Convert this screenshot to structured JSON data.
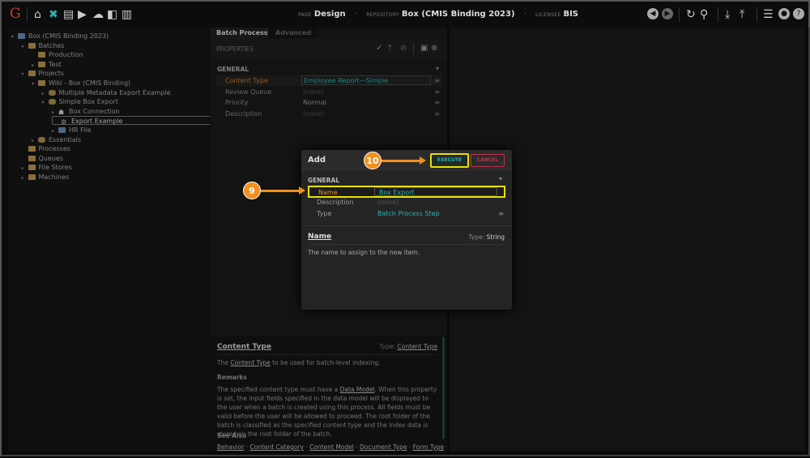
{
  "topbar": {
    "logo": "G",
    "icons": [
      "home-icon",
      "tools-icon",
      "archive-icon",
      "media-icon",
      "cloud-upload-icon",
      "briefcase-clock-icon",
      "chart-icon"
    ],
    "page_label": "PAGE",
    "page": "Design",
    "repo_label": "REPOSITORY",
    "repo": "Box (CMIS Binding 2023)",
    "licensee_label": "LICENSEE",
    "licensee": "BIS"
  },
  "tree": [
    {
      "label": "Box (CMIS Binding 2023)",
      "depth": 0,
      "tw": "▾",
      "icon": "repo"
    },
    {
      "label": "Batches",
      "depth": 1,
      "tw": "▾",
      "icon": "folder"
    },
    {
      "label": "Production",
      "depth": 2,
      "tw": "",
      "icon": "folder"
    },
    {
      "label": "Test",
      "depth": 2,
      "tw": "▸",
      "icon": "folder"
    },
    {
      "label": "Projects",
      "depth": 1,
      "tw": "▾",
      "icon": "folder"
    },
    {
      "label": "Wiki - Box (CMIS Binding)",
      "depth": 2,
      "tw": "▾",
      "icon": "folder"
    },
    {
      "label": "Multiple Metadata Export Example",
      "depth": 3,
      "tw": "▸",
      "icon": "package"
    },
    {
      "label": "Simple Box Export",
      "depth": 3,
      "tw": "▾",
      "icon": "package"
    },
    {
      "label": "Box Connection",
      "depth": 4,
      "tw": "▸",
      "icon": "connection"
    },
    {
      "label": "Export Example",
      "depth": 4,
      "tw": "",
      "icon": "gear",
      "selected": true
    },
    {
      "label": "HR File",
      "depth": 4,
      "tw": "▸",
      "icon": "file"
    },
    {
      "label": "Essentials",
      "depth": 2,
      "tw": "▸",
      "icon": "package"
    },
    {
      "label": "Processes",
      "depth": 1,
      "tw": "",
      "icon": "folder"
    },
    {
      "label": "Queues",
      "depth": 1,
      "tw": "",
      "icon": "folder"
    },
    {
      "label": "File Stores",
      "depth": 1,
      "tw": "▸",
      "icon": "folder"
    },
    {
      "label": "Machines",
      "depth": 1,
      "tw": "▸",
      "icon": "folder"
    }
  ],
  "props": {
    "tabs": [
      "Batch Process",
      "Advanced"
    ],
    "header": "PROPERTIES",
    "section": "GENERAL",
    "rows": [
      {
        "label": "Content Type",
        "value": "Employee Report—Simple"
      },
      {
        "label": "Review Queue",
        "value": "(none)"
      },
      {
        "label": "Priority",
        "value": "Normal"
      },
      {
        "label": "Description",
        "value": "(none)"
      }
    ]
  },
  "help": {
    "title": "Content Type",
    "type_label": "Type:",
    "type": "Content Type",
    "desc_pre": "The ",
    "desc_link": "Content Type",
    "desc_post": " to be used for batch-level indexing.",
    "remarks_title": "Remarks",
    "remarks_pre": "The specified content type must have a ",
    "remarks_link": "Data Model",
    "remarks_post": ". When this property is set, the input fields specified in the data model will be displayed to the user when a batch is created using this process. All fields must be valid before the user will be allowed to proceed. The root folder of the batch is classified as the specified content type and the index data is stored on the root folder of the batch.",
    "see_also_title": "See Also",
    "see_also": [
      "Behavior",
      "Content Category",
      "Content Model",
      "Document Type",
      "Form Type"
    ]
  },
  "dialog": {
    "title": "Add",
    "execute": "EXECUTE",
    "cancel": "CANCEL",
    "section": "GENERAL",
    "rows": [
      {
        "label": "Name",
        "value": "Box Export"
      },
      {
        "label": "Description",
        "value": "(none)"
      },
      {
        "label": "Type",
        "value": "Batch Process Step"
      }
    ],
    "help_title": "Name",
    "help_type_label": "Type:",
    "help_type": "String",
    "help_desc": "The name to assign to the new item."
  },
  "annotations": {
    "step9": "9",
    "step10": "10"
  },
  "colors": {
    "accent": "#2ab3b3",
    "orange": "#f0901e",
    "highlight": "#e8e000",
    "cancel": "#c0304a"
  }
}
